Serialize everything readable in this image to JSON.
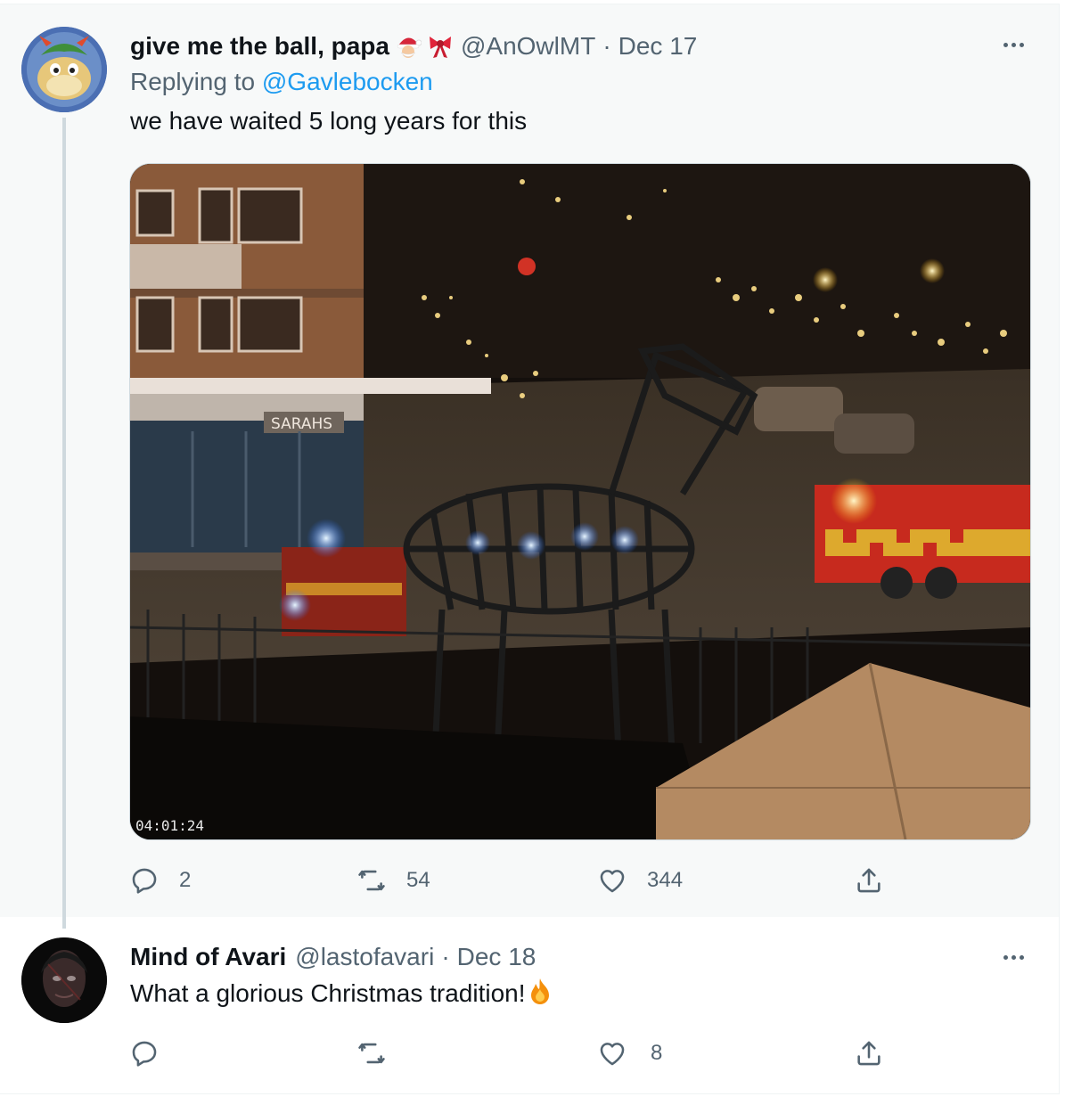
{
  "tweet1": {
    "display_name": "give me the ball, papa",
    "emoji_icons": [
      "santa-face-icon",
      "ribbon-bow-icon"
    ],
    "handle": "@AnOwlMT",
    "separator": "·",
    "date": "Dec 17",
    "replying_prefix": "Replying to",
    "replying_handle": "@Gavlebocken",
    "text": "we have waited 5 long years for this",
    "media": {
      "timestamp": "04:01:24",
      "station_sign": "SARAHS"
    },
    "actions": {
      "replies": "2",
      "retweets": "54",
      "likes": "344"
    }
  },
  "tweet2": {
    "display_name": "Mind of Avari",
    "handle": "@lastofavari",
    "separator": "·",
    "date": "Dec 18",
    "text": "What a glorious Christmas tradition!",
    "trailing_emoji": "fire-icon",
    "actions": {
      "replies": "",
      "retweets": "",
      "likes": "8"
    }
  },
  "colors": {
    "link": "#1d9bf0",
    "muted": "#536471",
    "thread_line": "#cfd9de",
    "focused_bg": "#f7f9f9"
  }
}
